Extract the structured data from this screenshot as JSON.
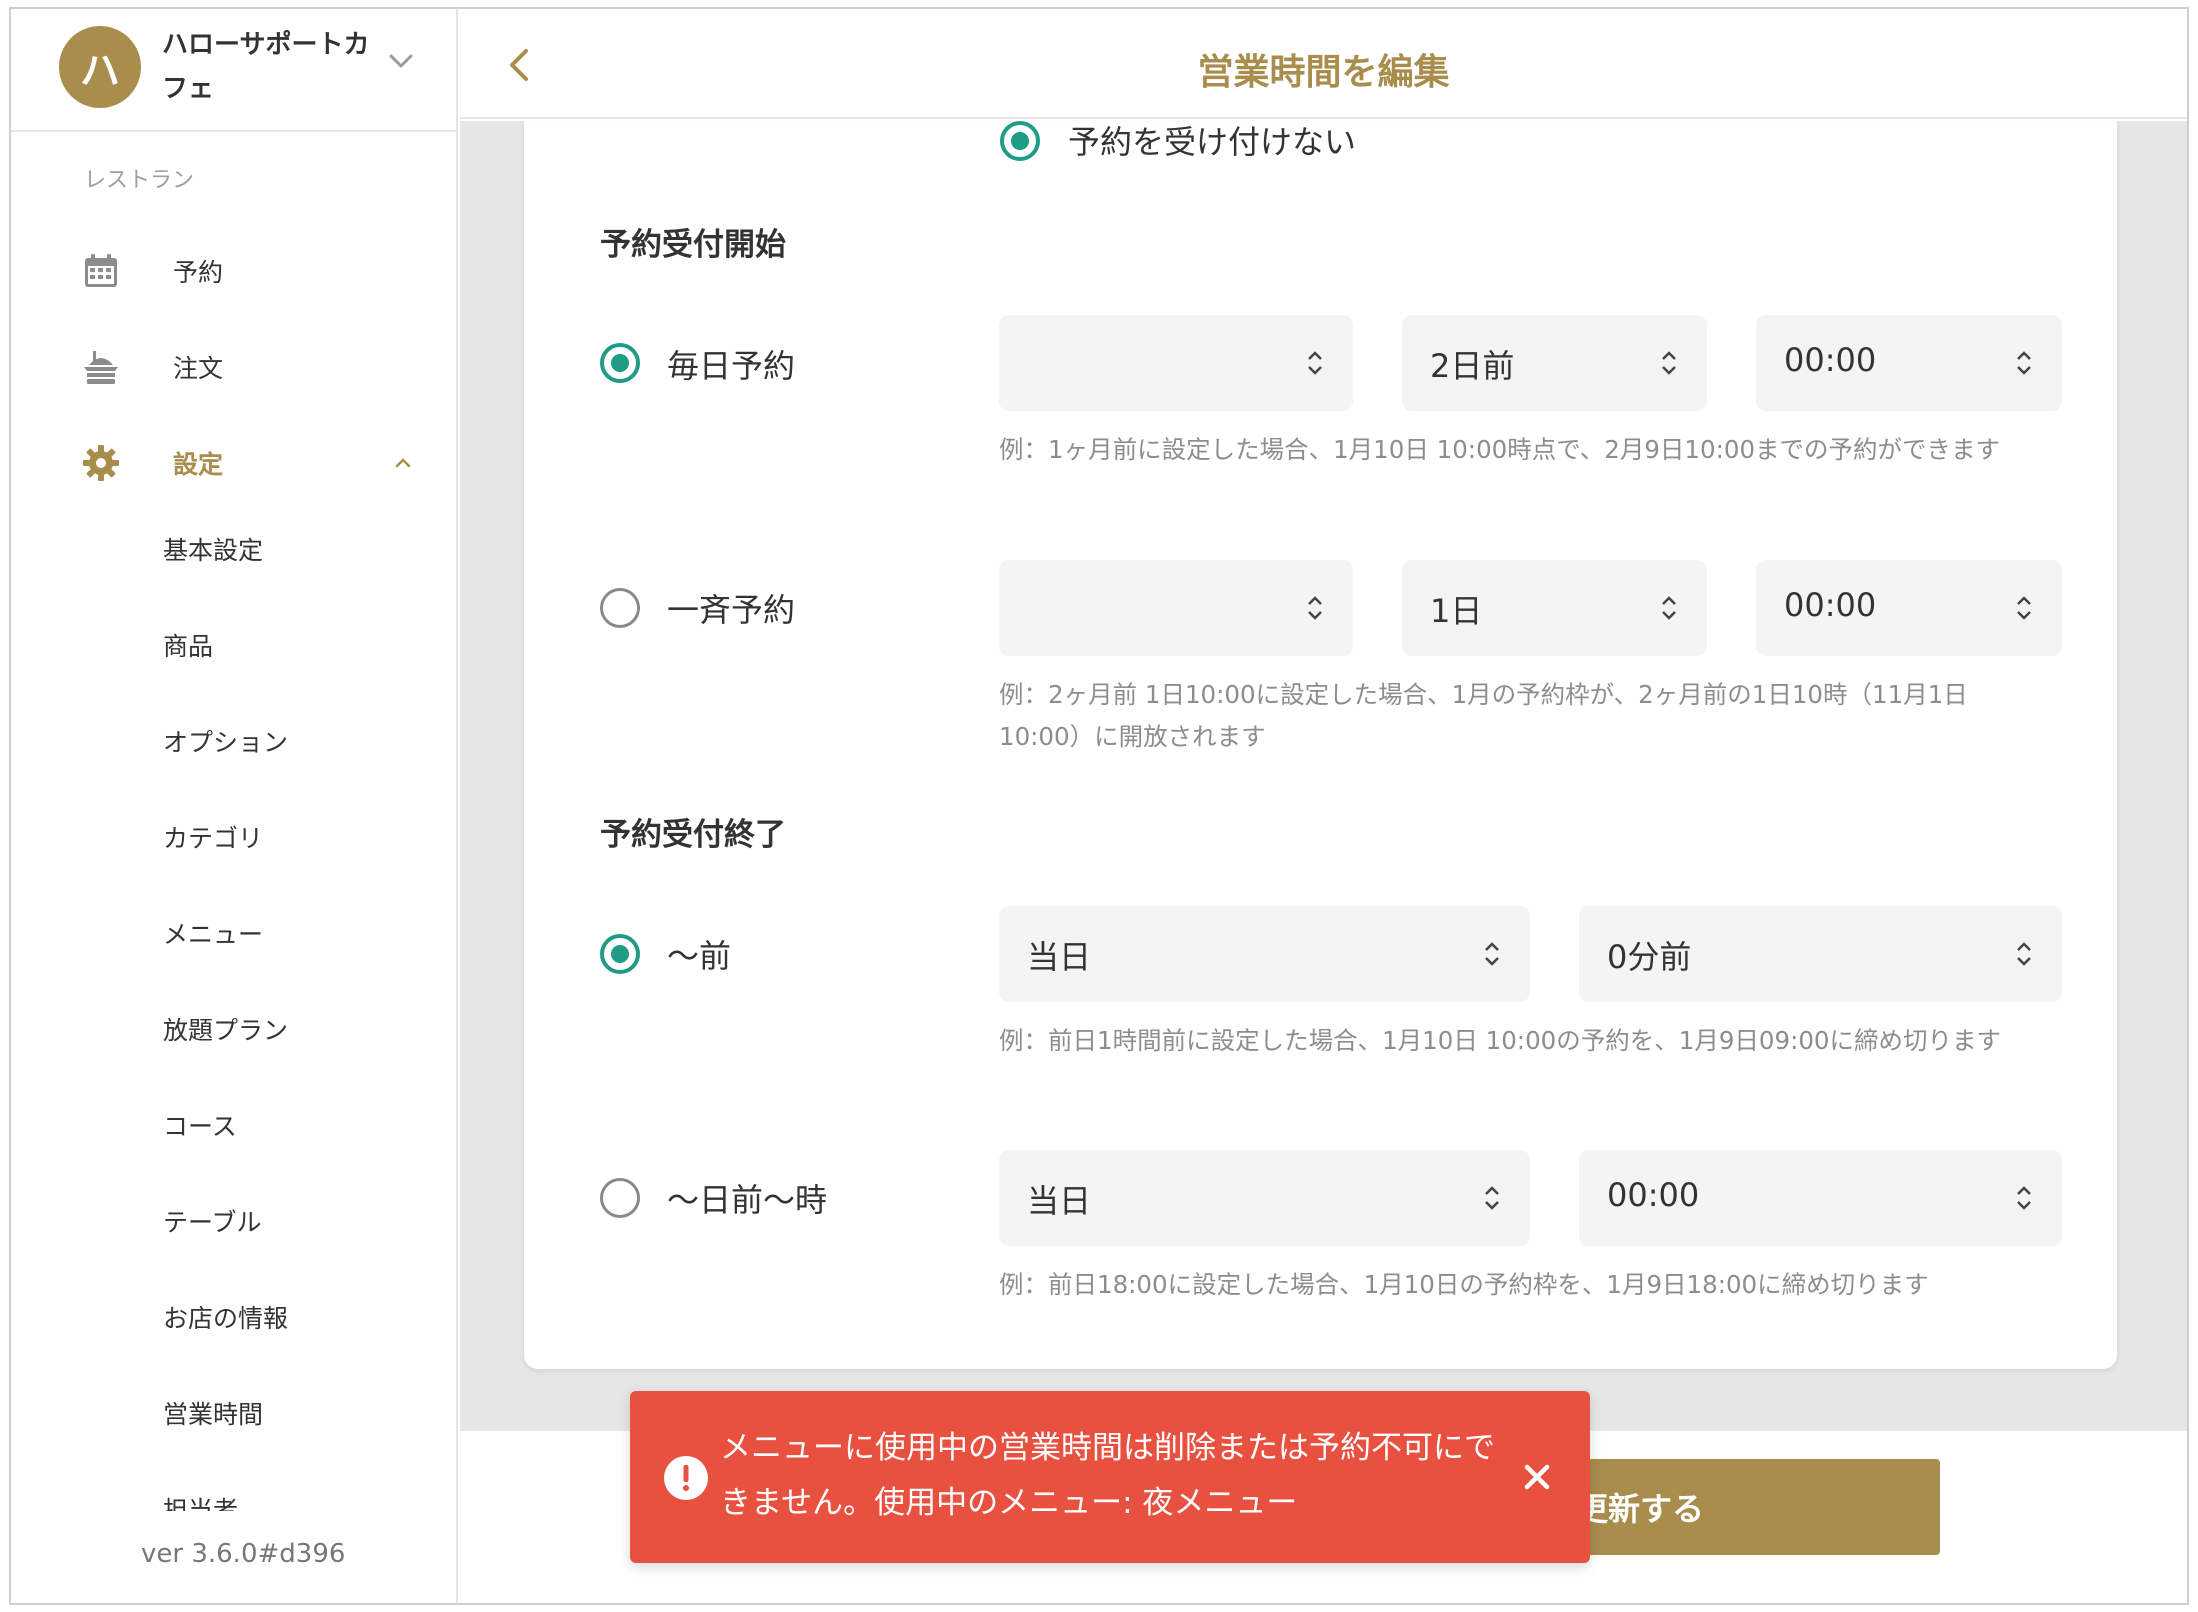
{
  "sidebar": {
    "store_initial": "ハ",
    "store_name": "ハローサポートカフェ",
    "section_label": "レストラン",
    "nav": {
      "reservation": "予約",
      "order": "注文",
      "settings": "設定"
    },
    "sub_items": [
      "基本設定",
      "商品",
      "オプション",
      "カテゴリ",
      "メニュー",
      "放題プラン",
      "コース",
      "テーブル",
      "お店の情報",
      "営業時間",
      "担当者"
    ],
    "version": "ver 3.6.0#d396"
  },
  "header": {
    "title": "営業時間を編集"
  },
  "form": {
    "top_option": "予約を受け付けない",
    "start_section": {
      "title": "予約受付開始",
      "daily": {
        "label": "毎日予約",
        "checked": true,
        "select1": "",
        "select2": "2日前",
        "select3": "00:00",
        "hint": "例：1ヶ月前に設定した場合、1月10日 10:00時点で、2月9日10:00までの予約ができます"
      },
      "bulk": {
        "label": "一斉予約",
        "checked": false,
        "select1": "",
        "select2": "1日",
        "select3": "00:00",
        "hint": "例：2ヶ月前 1日10:00に設定した場合、1月の予約枠が、2ヶ月前の1日10時（11月1日 10:00）に開放されます"
      }
    },
    "end_section": {
      "title": "予約受付終了",
      "before": {
        "label": "〜前",
        "checked": true,
        "select1": "当日",
        "select2": "0分前",
        "hint": "例：前日1時間前に設定した場合、1月10日 10:00の予約を、1月9日09:00に締め切ります"
      },
      "days_before_time": {
        "label": "〜日前〜時",
        "checked": false,
        "select1": "当日",
        "select2": "00:00",
        "hint": "例：前日18:00に設定した場合、1月10日の予約枠を、1月9日18:00に締め切ります"
      }
    }
  },
  "actions": {
    "update_label": "更新する"
  },
  "toast": {
    "message": "メニューに使用中の営業時間は削除または予約不可にできません。使用中のメニュー: 夜メニュー"
  },
  "colors": {
    "brand": "#a98d4d",
    "radio": "#1f9b87",
    "toast": "#e8503f"
  }
}
